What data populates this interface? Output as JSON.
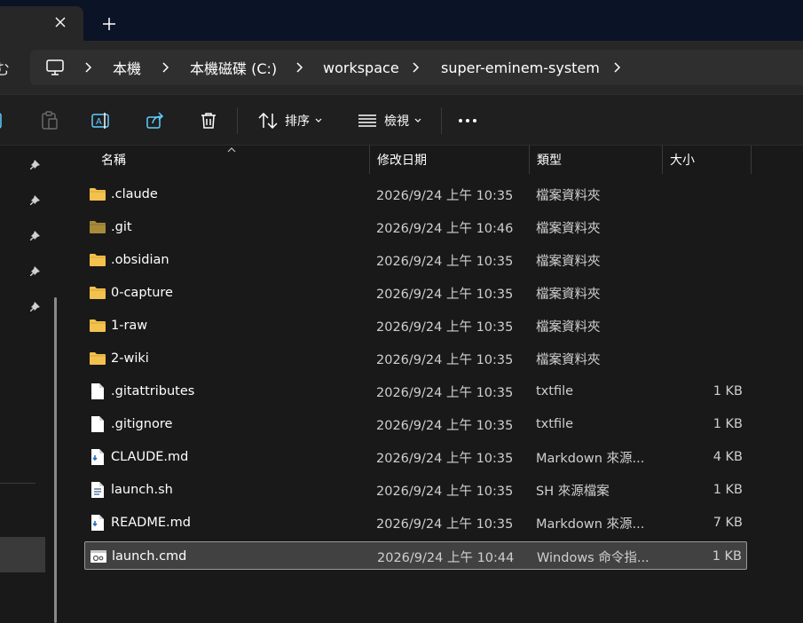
{
  "breadcrumb": [
    "本機",
    "本機磁碟 (C:)",
    "workspace",
    "super-eminem-system"
  ],
  "addr_left_glyph": "む",
  "commands": {
    "sort_label": "排序",
    "view_label": "檢視"
  },
  "columns": {
    "name": "名稱",
    "date": "修改日期",
    "type": "類型",
    "size": "大小"
  },
  "files": [
    {
      "name": ".claude",
      "date": "2026/9/24 上午 10:35",
      "type": "檔案資料夾",
      "size": "",
      "icon": "folder-icon"
    },
    {
      "name": ".git",
      "date": "2026/9/24 上午 10:46",
      "type": "檔案資料夾",
      "size": "",
      "icon": "folder-dim-icon"
    },
    {
      "name": ".obsidian",
      "date": "2026/9/24 上午 10:35",
      "type": "檔案資料夾",
      "size": "",
      "icon": "folder-icon"
    },
    {
      "name": "0-capture",
      "date": "2026/9/24 上午 10:35",
      "type": "檔案資料夾",
      "size": "",
      "icon": "folder-icon"
    },
    {
      "name": "1-raw",
      "date": "2026/9/24 上午 10:35",
      "type": "檔案資料夾",
      "size": "",
      "icon": "folder-icon"
    },
    {
      "name": "2-wiki",
      "date": "2026/9/24 上午 10:35",
      "type": "檔案資料夾",
      "size": "",
      "icon": "folder-icon"
    },
    {
      "name": ".gitattributes",
      "date": "2026/9/24 上午 10:35",
      "type": "txtfile",
      "size": "1 KB",
      "icon": "file-icon"
    },
    {
      "name": ".gitignore",
      "date": "2026/9/24 上午 10:35",
      "type": "txtfile",
      "size": "1 KB",
      "icon": "file-icon"
    },
    {
      "name": "CLAUDE.md",
      "date": "2026/9/24 上午 10:35",
      "type": "Markdown 來源...",
      "size": "4 KB",
      "icon": "markdown-file-icon"
    },
    {
      "name": "launch.sh",
      "date": "2026/9/24 上午 10:35",
      "type": "SH 來源檔案",
      "size": "1 KB",
      "icon": "script-file-icon"
    },
    {
      "name": "README.md",
      "date": "2026/9/24 上午 10:35",
      "type": "Markdown 來源...",
      "size": "7 KB",
      "icon": "markdown-file-icon"
    },
    {
      "name": "launch.cmd",
      "date": "2026/9/24 上午 10:44",
      "type": "Windows 命令指...",
      "size": "1 KB",
      "icon": "cmd-file-icon",
      "selected": true
    }
  ],
  "colors": {
    "folder": "#f2c14e",
    "folder_dim": "#a88a3a",
    "titlebar": "#0b1326",
    "selection": "#414141"
  }
}
